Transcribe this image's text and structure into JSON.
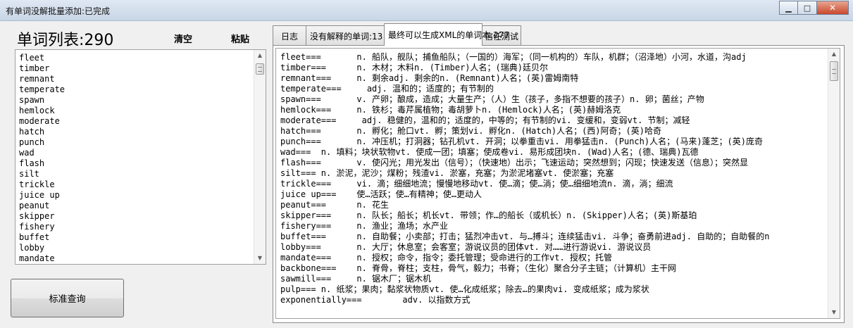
{
  "window": {
    "title": "有单词没解批量添加:已完成",
    "minimize": "▁",
    "maximize": "□",
    "close": "✕"
  },
  "left": {
    "count_label": "单词列表:290",
    "clear_label": "清空",
    "paste_label": "粘贴",
    "words": [
      "fleet",
      "timber",
      "remnant",
      "temperate",
      "spawn",
      "hemlock",
      "moderate",
      "hatch",
      "punch",
      "wad",
      "flash",
      "silt",
      "trickle",
      "juice up",
      "peanut",
      "skipper",
      "fishery",
      "buffet",
      "lobby",
      "mandate"
    ],
    "query_button": "标准查询"
  },
  "tabs": [
    {
      "label": "日志"
    },
    {
      "label": "没有解释的单词:13"
    },
    {
      "label": "最终可以生成XML的单词本:277"
    },
    {
      "label": "信任测试"
    }
  ],
  "active_tab": 2,
  "scroll_arrows": {
    "up": "▲",
    "down": "▼"
  },
  "output_lines": [
    "fleet===       n. 船队，舰队；捕鱼船队；（一国的）海军；（同一机构的）车队，机群；（沼泽地）小河，水道，沟adj",
    "timber===      n. 木材；木料n. (Timber)人名；(瑞典)廷贝尔",
    "remnant===     n. 剩余adj. 剩余的n. (Remnant)人名；(英)雷姆南特",
    "temperate===     adj. 温和的；适度的；有节制的",
    "spawn===       v. 产卵；酿成，造成；大量生产；（人）生（孩子，多指不想要的孩子）n. 卵；菌丝；产物",
    "hemlock===     n. 铁杉；毒芹属植物；毒胡萝卜n. (Hemlock)人名；(英)赫姆洛克",
    "moderate===     adj. 稳健的，温和的；适度的，中等的；有节制的vi. 变缓和，变弱vt. 节制；减轻",
    "hatch===       n. 孵化；舱口vt. 孵；策划vi. 孵化n. (Hatch)人名；(西)阿奇；(英)哈奇",
    "punch===       n. 冲压机；打洞器；钻孔机vt. 开洞；以拳重击vi. 用拳猛击n. (Punch)人名；(马来)蓬芝；(英)庞奇",
    "wad===  n. 填料；块状软物vt. 使成一团；填塞；使成卷vi. 易形成团块n. (Wad)人名；(德、瑞典)瓦德",
    "flash===       v. 使闪光；用光发出（信号）；（快速地）出示；飞速运动；突然想到；闪现；快速发送（信息）；突然显",
    "silt=== n. 淤泥，泥沙；煤粉；残渣vi. 淤塞，充塞；为淤泥堵塞vt. 使淤塞；充塞",
    "trickle===     vi. 滴；细细地流；慢慢地移动vt. 使…滴；使…淌；使…细细地流n. 滴，淌；细流",
    "juice up===    使…活跃；使…有精神；使…更动人",
    "peanut===      n. 花生",
    "skipper===     n. 队长；船长；机长vt. 带领；作…的船长（或机长）n. (Skipper)人名；(英)斯基珀",
    "fishery===     n. 渔业；渔场；水产业",
    "buffet===      n. 自助餐；小卖部；打击；猛烈冲击vt. 与…搏斗；连续猛击vi. 斗争；奋勇前进adj. 自助的；自助餐的n",
    "lobby===       n. 大厅；休息室；会客室；游说议员的团体vt. 对……进行游说vi. 游说议员",
    "mandate===     n. 授权；命令，指令；委托管理；受命进行的工作vt. 授权；托管",
    "backbone===    n. 脊骨，脊柱；支柱，骨气，毅力；书脊；（生化）聚合分子主链；（计算机）主干网",
    "sawmill===     n. 锯木厂；锯木机",
    "pulp=== n. 纸浆；果肉；黏浆状物质vt. 使…化成纸浆；除去…的果肉vi. 变成纸浆；成为浆状",
    "exponentially===        adv. 以指数方式"
  ]
}
